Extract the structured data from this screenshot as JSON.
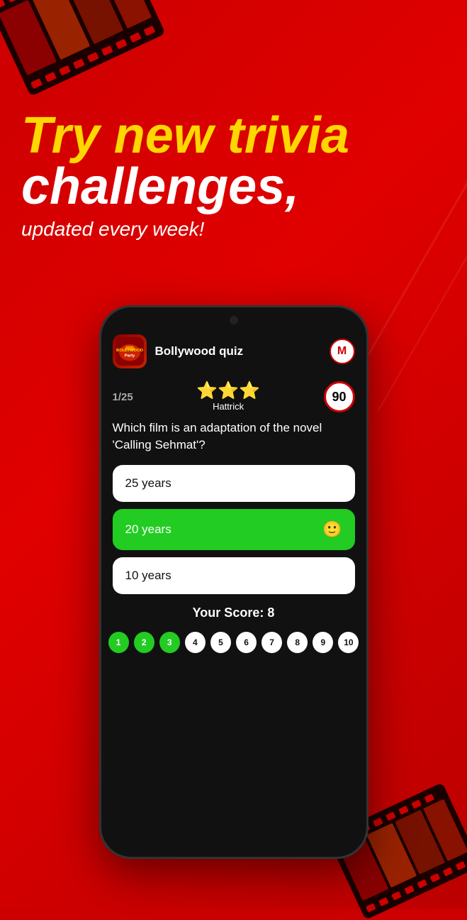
{
  "background": {
    "color": "#cc0000"
  },
  "header": {
    "line1_yellow": "Try new trivia",
    "line2_white": "challenges,",
    "subheading": "updated every week!"
  },
  "app": {
    "name": "Bollywood quiz",
    "icon_text": "BOLLYWOOD\nParty",
    "avatar_letter": "M"
  },
  "quiz": {
    "counter": "1/25",
    "hattrick_label": "Hattrick",
    "stars": "⭐⭐⭐",
    "timer_value": "90",
    "question": "Which film is an adaptation of the novel 'Calling Sehmat'?",
    "answers": [
      {
        "text": "25 years",
        "style": "white"
      },
      {
        "text": "20 years",
        "style": "green",
        "emoji": "🙂"
      },
      {
        "text": "10 years",
        "style": "white"
      }
    ]
  },
  "score": {
    "label": "Your Score: 8"
  },
  "progress": {
    "dots": [
      {
        "number": "1",
        "style": "filled-green"
      },
      {
        "number": "2",
        "style": "filled-green"
      },
      {
        "number": "3",
        "style": "filled-green"
      },
      {
        "number": "4",
        "style": "filled-white"
      },
      {
        "number": "5",
        "style": "filled-white"
      },
      {
        "number": "6",
        "style": "filled-white"
      },
      {
        "number": "7",
        "style": "filled-white"
      },
      {
        "number": "8",
        "style": "filled-white"
      },
      {
        "number": "9",
        "style": "filled-white"
      },
      {
        "number": "10",
        "style": "filled-white"
      }
    ]
  }
}
